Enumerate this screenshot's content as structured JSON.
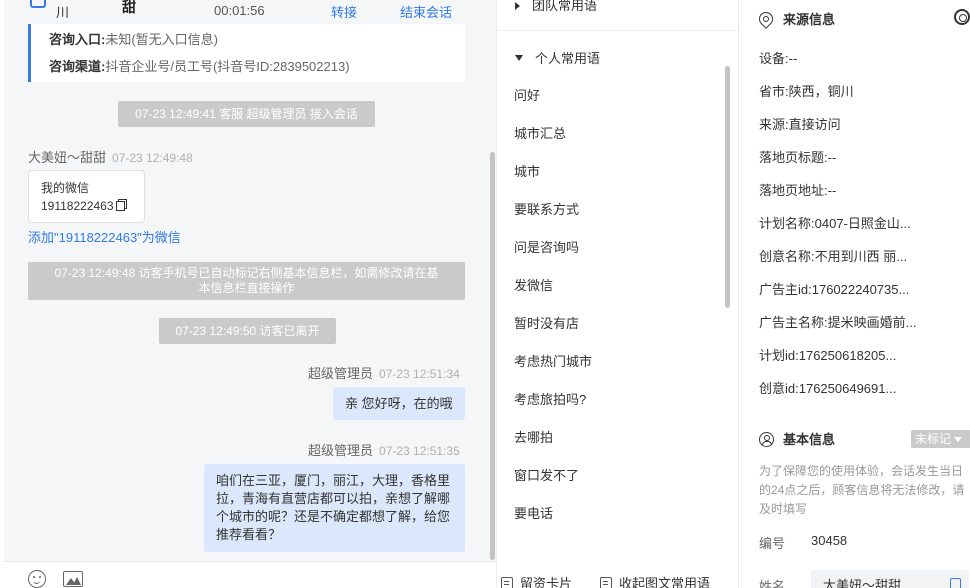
{
  "chat": {
    "header": {
      "location_short": "川",
      "name_short": "甜",
      "duration": "00:01:56",
      "transfer_label": "转接",
      "end_label": "结束会话"
    },
    "info_card": {
      "entry_label": "咨询入口:",
      "entry_value": "未知(暂无入口信息)",
      "channel_label": "咨询渠道:",
      "channel_value": "抖音企业号/员工号(抖音号ID:2839502213)"
    },
    "system_join": "07-23 12:49:41 客服 超级管理员 接入会话",
    "visitor_sender": "大美妞～甜甜",
    "visitor_time": "07-23 12:49:48",
    "wechat_card": {
      "title": "我的微信",
      "number": "19118222463"
    },
    "add_wechat_link": "添加\"19118222463\"为微信",
    "system_phone_line1": "07-23 12:49:48 访客手机号已自动标记右侧基本信息栏，如需修改请在基",
    "system_phone_line2": "本信息栏直接操作",
    "system_left": "07-23 12:49:50 访客已离开",
    "agent_msg1": {
      "sender": "超级管理员",
      "time": "07-23 12:51:34",
      "text": "亲 您好呀，在的哦"
    },
    "agent_msg2": {
      "sender": "超级管理员",
      "time": "07-23 12:51:35",
      "lines": [
        "咱们在三亚，厦门，丽江，大理，香格里",
        "拉，青海有直营店都可以拍，亲想了解哪",
        "个城市的呢？还是不确定都想了解，给您",
        "推荐看看？"
      ]
    },
    "icons": {
      "emoji": "emoji-icon",
      "image": "image-icon"
    }
  },
  "phrases": {
    "team_group": "团队常用语",
    "personal_group": "个人常用语",
    "items": [
      "问好",
      "城市汇总",
      "城市",
      "要联系方式",
      "问是咨询吗",
      "发微信",
      "暂时没有店",
      "考虑热门城市",
      "考虑旅拍吗?",
      "去哪拍",
      "窗口发不了",
      "要电话"
    ],
    "footer_card": "留资卡片",
    "footer_collapse": "收起图文常用语"
  },
  "info": {
    "source_title": "来源信息",
    "source_rows": [
      {
        "label": "设备:",
        "value": "--"
      },
      {
        "label": "省市:",
        "value": "陕西，铜川"
      },
      {
        "label": "来源:",
        "value": "直接访问"
      },
      {
        "label": "落地页标题:",
        "value": "--"
      },
      {
        "label": "落地页地址:",
        "value": "--"
      },
      {
        "label": "计划名称:",
        "value": "0407-日照金山..."
      },
      {
        "label": "创意名称:",
        "value": "不用到川西 丽..."
      },
      {
        "label": "广告主id:",
        "value": "176022240735..."
      },
      {
        "label": "广告主名称:",
        "value": "提米映画婚前..."
      },
      {
        "label": "计划id:",
        "value": "176250618205..."
      },
      {
        "label": "创意id:",
        "value": "176250649691..."
      }
    ],
    "basic_title": "基本信息",
    "tag_label": "未标记",
    "note": "为了保障您的使用体验，会话发生当日的24点之后，顾客信息将无法修改，请及时填写",
    "id_label": "编号",
    "id_value": "30458",
    "name_label": "姓名",
    "name_value": "大美妞～甜甜"
  },
  "colors": {
    "accent": "#2f7ae6",
    "bubble": "#dbe8fb",
    "system_gray": "#c9cacc"
  }
}
